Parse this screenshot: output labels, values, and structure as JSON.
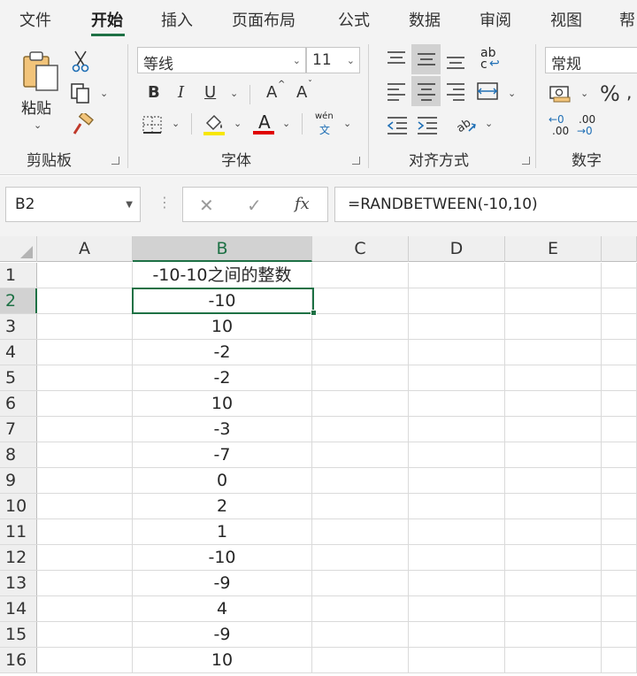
{
  "tabs": [
    "文件",
    "开始",
    "插入",
    "页面布局",
    "公式",
    "数据",
    "审阅",
    "视图",
    "帮"
  ],
  "active_tab": "开始",
  "ribbon": {
    "clipboard": {
      "paste_label": "粘贴",
      "group_label": "剪贴板"
    },
    "font": {
      "font_name": "等线",
      "font_size": "11",
      "group_label": "字体",
      "bold": "B",
      "italic": "I",
      "underline": "U",
      "grow": "A",
      "shrink": "A",
      "phonetic_top": "wén",
      "phonetic_bottom": "文",
      "font_color_letter": "A"
    },
    "alignment": {
      "group_label": "对齐方式",
      "wrap_top": "ab",
      "wrap_bottom": "c"
    },
    "number": {
      "format": "常规",
      "group_label": "数字",
      "percent": "%",
      "inc_top": "←0",
      "inc_bottom": ".00",
      "dec_top": ".00",
      "dec_bottom": "→0"
    }
  },
  "formula_bar": {
    "name_box": "B2",
    "cancel": "✕",
    "enter": "✓",
    "fx": "fx",
    "formula": "=RANDBETWEEN(-10,10)"
  },
  "grid": {
    "columns": [
      "A",
      "B",
      "C",
      "D",
      "E"
    ],
    "selected_column": "B",
    "selected_row": "2",
    "rows": [
      {
        "num": "1",
        "b": "-10-10之间的整数"
      },
      {
        "num": "2",
        "b": "-10"
      },
      {
        "num": "3",
        "b": "10"
      },
      {
        "num": "4",
        "b": "-2"
      },
      {
        "num": "5",
        "b": "-2"
      },
      {
        "num": "6",
        "b": "10"
      },
      {
        "num": "7",
        "b": "-3"
      },
      {
        "num": "8",
        "b": "-7"
      },
      {
        "num": "9",
        "b": "0"
      },
      {
        "num": "10",
        "b": "2"
      },
      {
        "num": "11",
        "b": "1"
      },
      {
        "num": "12",
        "b": "-10"
      },
      {
        "num": "13",
        "b": "-9"
      },
      {
        "num": "14",
        "b": "4"
      },
      {
        "num": "15",
        "b": "-9"
      },
      {
        "num": "16",
        "b": "10"
      }
    ]
  },
  "colors": {
    "accent": "#1e7145",
    "highlight_yellow": "#f7e600",
    "font_red": "#e00000"
  },
  "icons": [
    "paste-icon",
    "cut-icon",
    "copy-icon",
    "format-painter-icon",
    "borders-icon",
    "fill-color-icon",
    "font-color-icon",
    "phonetic-icon",
    "align-top-icon",
    "align-middle-icon",
    "align-bottom-icon",
    "wrap-text-icon",
    "align-left-icon",
    "align-center-icon",
    "align-right-icon",
    "merge-center-icon",
    "decrease-indent-icon",
    "increase-indent-icon",
    "orientation-icon",
    "accounting-format-icon",
    "percent-icon",
    "increase-decimal-icon",
    "decrease-decimal-icon"
  ]
}
